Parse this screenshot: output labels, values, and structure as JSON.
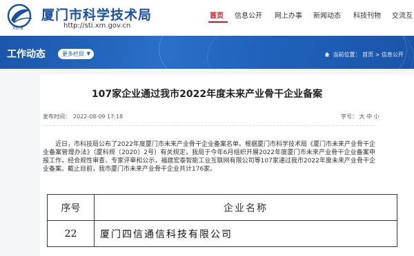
{
  "header": {
    "site_title": "厦门市科学技术局",
    "site_url": "http://sti.xm.gov.cn",
    "logo_text": "XSTB",
    "nav": [
      {
        "label": "首页",
        "active": true
      },
      {
        "label": "信息公开",
        "active": false
      },
      {
        "label": "网上办事",
        "active": false
      },
      {
        "label": "新闻动态",
        "active": false
      },
      {
        "label": "科技刊物",
        "active": false
      },
      {
        "label": "交流互",
        "active": false
      }
    ]
  },
  "banner": {
    "section_title": "工作动态",
    "more_label": "更多栏目",
    "breadcrumb": {
      "prefix": "当前位置：",
      "home": "首页",
      "sep": ">",
      "current": "信息公开"
    }
  },
  "article": {
    "title": "107家企业通过我市2022年度未来产业骨干企业备案",
    "publish_label": "发布时间：",
    "publish_time": "2022-08-09 17:18",
    "font_label": "字号：",
    "font_sizes": [
      "大",
      "中",
      "小"
    ],
    "body": "近日，市科技局公布了2022年度厦门市未来产业骨干企业备案名单。根据厦门市科学技术局《厦门市未来产业骨干企业备案管理办法》（厦科规〔2020〕2号）有关规定，我局于今年6月组织开展2022年度厦门市未来产业骨干企业备案申报工作，经合规性审查、专家评审和公示，福建宏泰智能工业互联网有限公司等107家通过我市2022年度未来产业骨干企业备案。截止目前，我市厦门市未来产业骨干企业共计176家。"
  },
  "table": {
    "headers": [
      "序号",
      "企业名称"
    ],
    "rows": [
      {
        "no": "22",
        "name": "厦门四信通信科技有限公司"
      }
    ]
  },
  "colors": {
    "brand_blue": "#1b4fa0",
    "banner_blue": "#1d5db3",
    "nav_active": "#c8161d"
  }
}
